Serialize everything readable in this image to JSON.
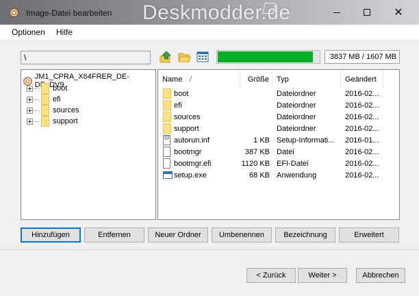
{
  "window": {
    "title": "Image-Datei bearbeiten",
    "watermark": "Deskmodder.de"
  },
  "menu": {
    "items": [
      "Optionen",
      "Hilfe"
    ]
  },
  "toolbar": {
    "path": "\\",
    "progress_fraction": 0.94,
    "size_readout": "3837 MB / 1607 MB",
    "progress_color": "#06b025"
  },
  "tree": {
    "root": "JM1_CPRA_X64FRER_DE-DE_DV9",
    "folders": [
      "boot",
      "efi",
      "sources",
      "support"
    ]
  },
  "list": {
    "columns": [
      "Name",
      "Größe",
      "Typ",
      "Geändert"
    ],
    "sort_indicator": "/",
    "rows": [
      {
        "name": "boot",
        "size": "",
        "type": "Dateiordner",
        "modified": "2016-02...",
        "icon": "folder-icon"
      },
      {
        "name": "efi",
        "size": "",
        "type": "Dateiordner",
        "modified": "2016-02...",
        "icon": "folder-icon"
      },
      {
        "name": "sources",
        "size": "",
        "type": "Dateiordner",
        "modified": "2016-02...",
        "icon": "folder-icon"
      },
      {
        "name": "support",
        "size": "",
        "type": "Dateiordner",
        "modified": "2016-02...",
        "icon": "folder-icon"
      },
      {
        "name": "autorun.inf",
        "size": "1 KB",
        "type": "Setup-Informati...",
        "modified": "2016-01...",
        "icon": "settings-file-icon"
      },
      {
        "name": "bootmgr",
        "size": "387 KB",
        "type": "Datei",
        "modified": "2016-02...",
        "icon": "file-icon"
      },
      {
        "name": "bootmgr.efi",
        "size": "1120 KB",
        "type": "EFI-Datei",
        "modified": "2016-02...",
        "icon": "file-icon"
      },
      {
        "name": "setup.exe",
        "size": "68 KB",
        "type": "Anwendung",
        "modified": "2016-02...",
        "icon": "application-icon"
      }
    ]
  },
  "actions": {
    "add": "Hinzufügen",
    "remove": "Entfernen",
    "new_folder": "Neuer Ordner",
    "rename": "Umbenennen",
    "label": "Bezeichnung",
    "advanced": "Erweitert"
  },
  "nav": {
    "back": "< Zurück",
    "next": "Weiter >",
    "cancel": "Abbrechen"
  }
}
